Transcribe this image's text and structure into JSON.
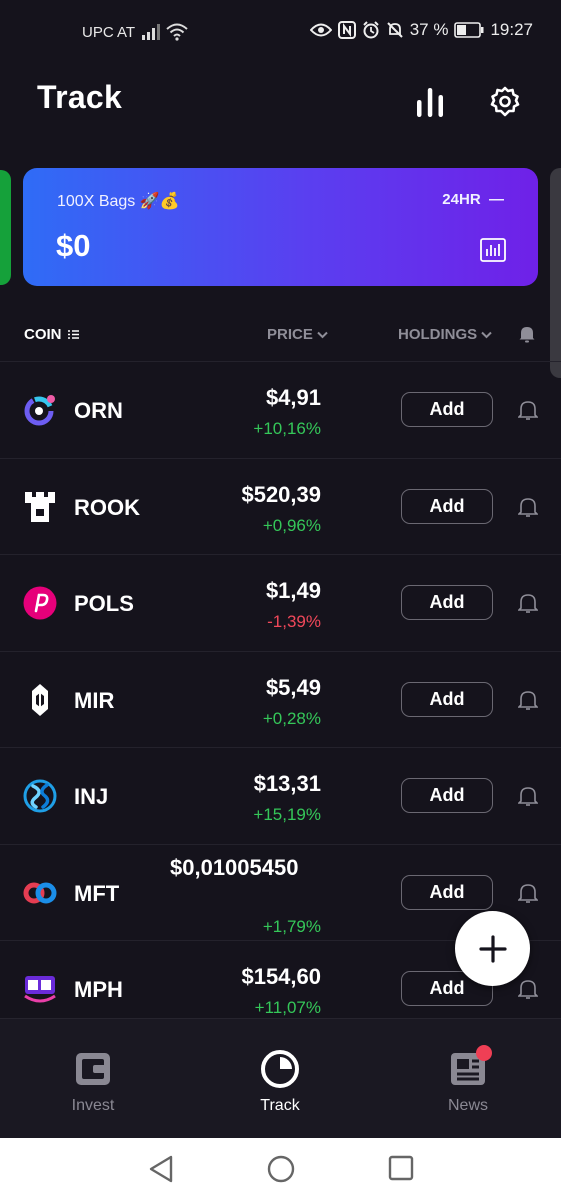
{
  "status_bar": {
    "carrier": "UPC AT",
    "battery": "37 %",
    "time": "19:27"
  },
  "header": {
    "title": "Track"
  },
  "portfolio": {
    "name": "100X Bags 🚀💰",
    "period": "24HR",
    "period_indicator": "—",
    "value": "$0"
  },
  "table": {
    "col_coin": "COIN",
    "col_price": "PRICE",
    "col_holdings": "HOLDINGS"
  },
  "coins": [
    {
      "symbol": "ORN",
      "price": "$4,91",
      "change": "+10,16%",
      "add_label": "Add"
    },
    {
      "symbol": "ROOK",
      "price": "$520,39",
      "change": "+0,96%",
      "add_label": "Add"
    },
    {
      "symbol": "POLS",
      "price": "$1,49",
      "change": "-1,39%",
      "add_label": "Add"
    },
    {
      "symbol": "MIR",
      "price": "$5,49",
      "change": "+0,28%",
      "add_label": "Add"
    },
    {
      "symbol": "INJ",
      "price": "$13,31",
      "change": "+15,19%",
      "add_label": "Add"
    },
    {
      "symbol": "MFT",
      "price": "$0,01005450",
      "change": "+1,79%",
      "add_label": "Add"
    },
    {
      "symbol": "MPH",
      "price": "$154,60",
      "change": "+11,07%",
      "add_label": "Add"
    }
  ],
  "nav": {
    "invest": "Invest",
    "track": "Track",
    "news": "News"
  },
  "colors": {
    "background": "#15131c",
    "positive": "#35c759",
    "negative": "#f0485a",
    "card_gradient_start": "#2f6cf6",
    "card_gradient_end": "#6f21e8"
  }
}
